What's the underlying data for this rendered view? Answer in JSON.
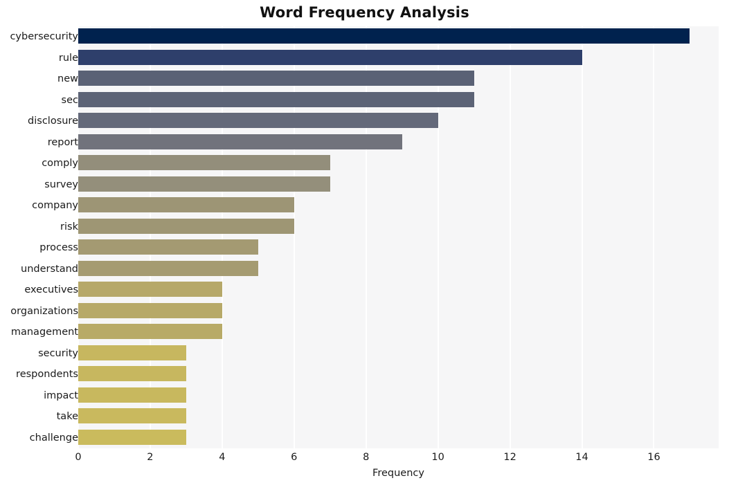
{
  "chart_data": {
    "type": "bar",
    "orientation": "horizontal",
    "title": "Word Frequency Analysis",
    "xlabel": "Frequency",
    "ylabel": "",
    "categories": [
      "cybersecurity",
      "rule",
      "new",
      "sec",
      "disclosure",
      "report",
      "comply",
      "survey",
      "company",
      "risk",
      "process",
      "understand",
      "executives",
      "organizations",
      "management",
      "security",
      "respondents",
      "impact",
      "take",
      "challenge"
    ],
    "values": [
      17,
      14,
      11,
      11,
      10,
      9,
      7,
      7,
      6,
      6,
      5,
      5,
      4,
      4,
      4,
      3,
      3,
      3,
      3,
      3
    ],
    "bar_colors": [
      "#00224e",
      "#2e3f6b",
      "#5a6175",
      "#5c6376",
      "#64697a",
      "#71737c",
      "#938e7b",
      "#948f7b",
      "#9d9575",
      "#9e9674",
      "#a49a72",
      "#a59b71",
      "#b6a869",
      "#b7a968",
      "#b8aa67",
      "#c7b75f",
      "#c7b75f",
      "#c8b85e",
      "#c9b95e",
      "#cabb5d"
    ],
    "xlim": [
      0,
      17.8
    ],
    "xticks": [
      0,
      2,
      4,
      6,
      8,
      10,
      12,
      14,
      16
    ],
    "grid": true,
    "grid_axis": "x",
    "grid_color": "#ffffff",
    "plot_background": "#f6f6f7",
    "figure_background": "#ffffff",
    "legend": null,
    "colormap": "cividis"
  }
}
